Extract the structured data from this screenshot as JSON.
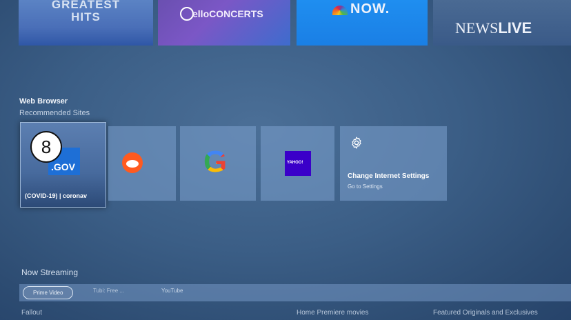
{
  "top_tiles": {
    "greatest_hits": "GREATEST\nHITS",
    "cello": "elloCONCERTS",
    "nbc_now": "NOW.",
    "news_live": [
      "NEWS",
      "LIVE"
    ]
  },
  "web_browser": {
    "title": "Web Browser",
    "subtitle": "Recommended Sites",
    "sites": {
      "gov": {
        "logo_text": ".GOV",
        "caption": "(COVID-19) | coronav"
      },
      "reddit": {},
      "google": {
        "logo_text": "G"
      },
      "yahoo": {
        "logo_text": "YAHOO!"
      },
      "settings": {
        "label": "Change Internet Settings",
        "sublabel": "Go to Settings"
      }
    },
    "badge": "8"
  },
  "now_streaming": {
    "title": "Now Streaming",
    "tabs": [
      "Prime Video",
      "Tubi: Free ...",
      "YouTube"
    ]
  },
  "bottom_row": {
    "left": "Fallout",
    "middle": "Home Premiere movies",
    "right": "Featured Originals and Exclusives"
  }
}
